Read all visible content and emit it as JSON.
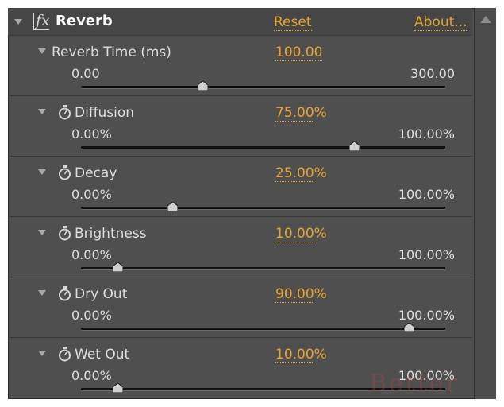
{
  "effect": {
    "name": "Reverb",
    "reset_label": "Reset",
    "about_label": "About...",
    "icon": "fx-icon"
  },
  "params": [
    {
      "label": "Reverb Time (ms)",
      "value": "100.00",
      "unit": "",
      "min": "0.00",
      "max": "300.00",
      "slider_fraction": 0.333,
      "has_stopwatch": false
    },
    {
      "label": "Diffusion",
      "value": "75.00",
      "unit": "%",
      "min": "0.00%",
      "max": "100.00%",
      "slider_fraction": 0.75,
      "has_stopwatch": true
    },
    {
      "label": "Decay",
      "value": "25.00",
      "unit": "%",
      "min": "0.00%",
      "max": "100.00%",
      "slider_fraction": 0.25,
      "has_stopwatch": true
    },
    {
      "label": "Brightness",
      "value": "10.00",
      "unit": "%",
      "min": "0.00%",
      "max": "100.00%",
      "slider_fraction": 0.1,
      "has_stopwatch": true
    },
    {
      "label": "Dry Out",
      "value": "90.00",
      "unit": "%",
      "min": "0.00%",
      "max": "100.00%",
      "slider_fraction": 0.9,
      "has_stopwatch": true
    },
    {
      "label": "Wet Out",
      "value": "10.00",
      "unit": "%",
      "min": "0.00%",
      "max": "100.00%",
      "slider_fraction": 0.1,
      "has_stopwatch": true
    }
  ],
  "colors": {
    "accent": "#e6a42a",
    "panel": "#4f4f4f",
    "text": "#dedede"
  },
  "watermark": "Better"
}
